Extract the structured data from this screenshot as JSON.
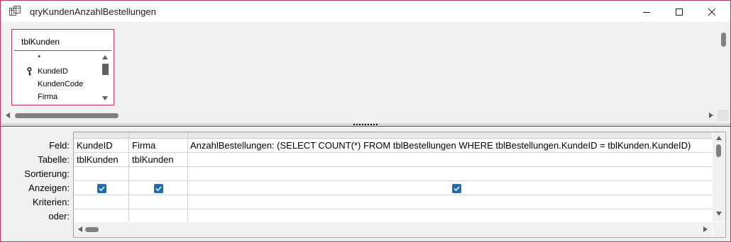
{
  "window": {
    "title": "qryKundenAnzahlBestellungen",
    "accent": "#b4354f"
  },
  "icons": {
    "app": "query-design-icon",
    "minimize": "minimize-icon",
    "maximize": "maximize-icon",
    "close": "close-icon",
    "primary_key": "key-icon",
    "checkbox": "checkbox-checked-icon"
  },
  "table_box": {
    "name": "tblKunden",
    "fields": [
      "*",
      "KundeID",
      "KundenCode",
      "Firma"
    ]
  },
  "grid": {
    "row_labels": [
      "Feld:",
      "Tabelle:",
      "Sortierung:",
      "Anzeigen:",
      "Kriterien:",
      "oder:"
    ],
    "columns": [
      {
        "feld": "KundeID",
        "tabelle": "tblKunden",
        "anzeigen": true
      },
      {
        "feld": "Firma",
        "tabelle": "tblKunden",
        "anzeigen": true
      },
      {
        "feld": "AnzahlBestellungen: (SELECT COUNT(*) FROM tblBestellungen WHERE tblBestellungen.KundeID = tblKunden.KundeID)",
        "tabelle": "",
        "anzeigen": true
      }
    ]
  }
}
